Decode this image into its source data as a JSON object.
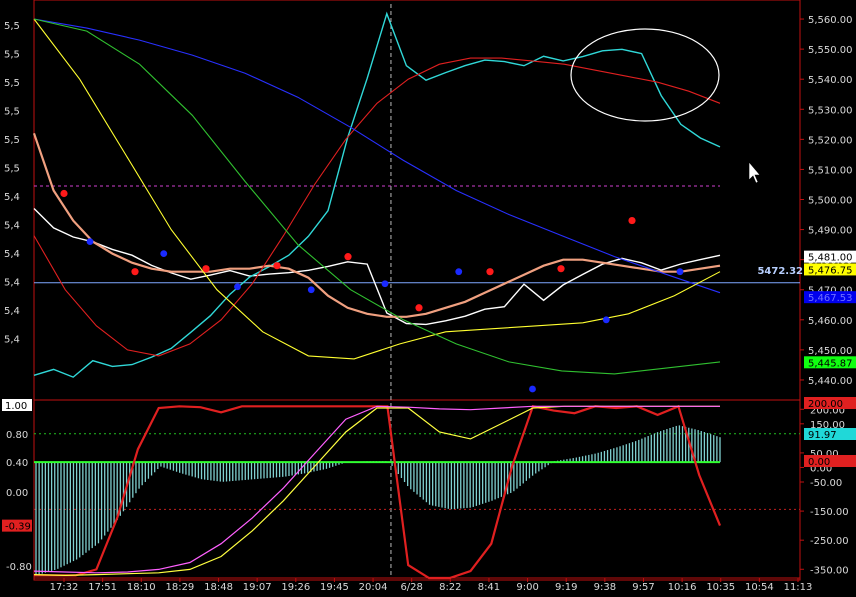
{
  "chart_data": [
    {
      "type": "line",
      "panel": "price",
      "ylim": [
        5435,
        5565
      ],
      "grid": false,
      "right_axis_ticks": [
        5440,
        5450,
        5460,
        5470,
        5480,
        5490,
        5500,
        5510,
        5520,
        5530,
        5540,
        5550,
        5560
      ],
      "right_axis_tick_labels": [
        "5,440.00",
        "5,450.00",
        "5,460.00",
        "5,470.00",
        "5,480.00",
        "5,490.00",
        "5,500.00",
        "5,510.00",
        "5,520.00",
        "5,530.00",
        "5,540.00",
        "5,550.00",
        "5,560.00"
      ],
      "left_axis_labels": [
        "5,5",
        "5,5",
        "5,5",
        "5,5",
        "5,5",
        "5,5",
        "5,4",
        "5,4",
        "5,4",
        "5,4",
        "5,4",
        "5,4"
      ],
      "x_tick_labels": [
        "17:32",
        "17:51",
        "18:10",
        "18:29",
        "18:48",
        "19:07",
        "19:26",
        "19:45",
        "20:04",
        "6/28",
        "8:22",
        "8:41",
        "9:00",
        "9:19",
        "9:38",
        "9:57",
        "10:16",
        "10:35",
        "10:54",
        "11:13"
      ],
      "session_break_label": "6/28",
      "price_line": {
        "value": 5472.32,
        "label": "5472.32",
        "color": "#ffffff"
      },
      "dotted_level": {
        "value": 5504.5,
        "color": "#d040d0"
      },
      "value_tags": [
        {
          "label": "5,481.00",
          "value": 5481.0,
          "bg": "#ffffff",
          "fg": "#000000"
        },
        {
          "label": "5,476.75",
          "value": 5476.75,
          "bg": "#ffff00",
          "fg": "#000000"
        },
        {
          "label": "5,467.53",
          "value": 5467.53,
          "bg": "#0000ee",
          "fg": "#7070ff"
        },
        {
          "label": "5,445.87",
          "value": 5445.87,
          "bg": "#10ff10",
          "fg": "#000000"
        }
      ],
      "series": [
        {
          "color": "#ffffff",
          "values": [
            5497,
            5491,
            5488,
            5486,
            5483,
            5481,
            5478,
            5476,
            5474,
            5475,
            5476,
            5474,
            5475,
            5476,
            5477,
            5478,
            5479,
            5478,
            5462,
            5459,
            5459,
            5460,
            5461,
            5463,
            5464,
            5472,
            5467,
            5472,
            5475,
            5478,
            5480,
            5479,
            5477,
            5479,
            5480,
            5481
          ]
        },
        {
          "color": "#30d8d8",
          "values": [
            5442,
            5444,
            5441,
            5446,
            5444,
            5445,
            5448,
            5451,
            5456,
            5461,
            5468,
            5474,
            5478,
            5482,
            5488,
            5496,
            5520,
            5540,
            5562,
            5545,
            5540,
            5542,
            5544,
            5546,
            5546,
            5545,
            5548,
            5546,
            5547,
            5549,
            5550,
            5549,
            5535,
            5525,
            5520,
            5517
          ]
        },
        {
          "color": "#f0a080",
          "values": [
            5522,
            5503,
            5493,
            5486,
            5482,
            5479,
            5477,
            5476,
            5476,
            5476,
            5477,
            5477,
            5478,
            5477,
            5474,
            5468,
            5464,
            5462,
            5461,
            5461,
            5462,
            5464,
            5466,
            5469,
            5472,
            5475,
            5478,
            5480,
            5480,
            5479,
            5478,
            5477,
            5476,
            5476,
            5477,
            5478
          ]
        },
        {
          "color": "#e02020",
          "values": [
            5488,
            5470,
            5458,
            5450,
            5448,
            5452,
            5460,
            5472,
            5488,
            5505,
            5520,
            5532,
            5540,
            5545,
            5547,
            5547,
            5546,
            5545,
            5543,
            5541,
            5539,
            5536,
            5532
          ]
        },
        {
          "color": "#2830ff",
          "values": [
            5560,
            5557,
            5553,
            5548,
            5542,
            5534,
            5524,
            5513,
            5503,
            5495,
            5488,
            5481,
            5475,
            5469
          ]
        },
        {
          "color": "#ffff30",
          "values": [
            5560,
            5540,
            5515,
            5490,
            5470,
            5456,
            5448,
            5447,
            5452,
            5456,
            5457,
            5458,
            5459,
            5462,
            5468,
            5476
          ]
        },
        {
          "color": "#30c030",
          "values": [
            5560,
            5556,
            5545,
            5528,
            5506,
            5485,
            5470,
            5460,
            5452,
            5446,
            5443,
            5442,
            5444,
            5446
          ]
        }
      ],
      "pivot_highs": [
        5502,
        5476,
        5477,
        5478,
        5481,
        5464,
        5476,
        5477,
        5493
      ],
      "pivot_lows": [
        5486,
        5482,
        5471,
        5470,
        5472,
        5476,
        5437,
        5460,
        5476
      ]
    },
    {
      "type": "area",
      "panel": "oscillator",
      "left_axis_tick_labels": [
        "0.80",
        "0.40",
        "0.00",
        "-0.80"
      ],
      "left_tags": [
        {
          "label": "1.00",
          "value": 1.0,
          "bg": "#ffffff",
          "fg": "#000000"
        },
        {
          "label": "-0.39",
          "value": -0.39,
          "bg": "#e02020",
          "fg": "#000000"
        }
      ],
      "right_axis_tick_labels": [
        "200.00",
        "150.00",
        "50.00",
        "0.00",
        "-50.00",
        "-150.00",
        "-250.00",
        "-350.00"
      ],
      "right_axis_ticks": [
        200,
        150,
        50,
        0,
        -50,
        -150,
        -250,
        -350
      ],
      "right_tags": [
        {
          "label": "200.00",
          "value": 200,
          "bg": "#e02020",
          "fg": "#000000"
        },
        {
          "label": "91.97",
          "value": 91.97,
          "bg": "#20d8d8",
          "fg": "#000000"
        },
        {
          "label": "0.00",
          "value": 0,
          "bg": "#e02020",
          "fg": "#000000"
        }
      ],
      "ylim": [
        -1.0,
        1.05
      ],
      "levels": [
        {
          "value": 0.68,
          "color": "#20c020"
        },
        {
          "value": -0.2,
          "color": "#c02020"
        }
      ],
      "zero_line": {
        "value": 0.35,
        "color": "#30ff30"
      },
      "series": [
        {
          "color": "#80d0d0",
          "kind": "histogram",
          "values": [
            -0.97,
            -0.9,
            -0.78,
            -0.6,
            -0.3,
            0.05,
            0.3,
            0.22,
            0.15,
            0.12,
            0.14,
            0.16,
            0.18,
            0.22,
            0.27,
            0.35,
            0.36,
            0.36,
            0.05,
            -0.15,
            -0.2,
            -0.18,
            -0.1,
            0.0,
            0.2,
            0.36,
            0.4,
            0.45,
            0.52,
            0.6,
            0.7,
            0.78,
            0.72,
            0.64
          ]
        },
        {
          "color": "#e02020",
          "values": [
            -0.97,
            -0.97,
            -0.97,
            -0.9,
            -0.3,
            0.5,
            0.98,
            1.0,
            0.99,
            0.93,
            1.0,
            1.0,
            1.0,
            1.0,
            1.0,
            1.0,
            1.0,
            1.0,
            -0.85,
            -1.0,
            -1.0,
            -0.92,
            -0.6,
            0.3,
            1.0,
            0.95,
            0.92,
            1.0,
            0.98,
            1.0,
            0.9,
            1.0,
            0.2,
            -0.39
          ]
        },
        {
          "color": "#ffff40",
          "values": [
            -0.96,
            -0.97,
            -0.96,
            -0.95,
            -0.94,
            -0.9,
            -0.75,
            -0.45,
            -0.1,
            0.3,
            0.7,
            0.98,
            0.98,
            0.7,
            0.62,
            0.8,
            0.98,
            1.0,
            1.0,
            1.0,
            1.0,
            1.0,
            1.0
          ]
        },
        {
          "color": "#ff60ff",
          "values": [
            -0.92,
            -0.93,
            -0.94,
            -0.93,
            -0.9,
            -0.82,
            -0.6,
            -0.3,
            0.05,
            0.45,
            0.85,
            1.0,
            0.99,
            0.97,
            0.96,
            0.98,
            1.0,
            1.0,
            1.0,
            1.0,
            1.0,
            1.0,
            1.0
          ]
        }
      ]
    }
  ]
}
